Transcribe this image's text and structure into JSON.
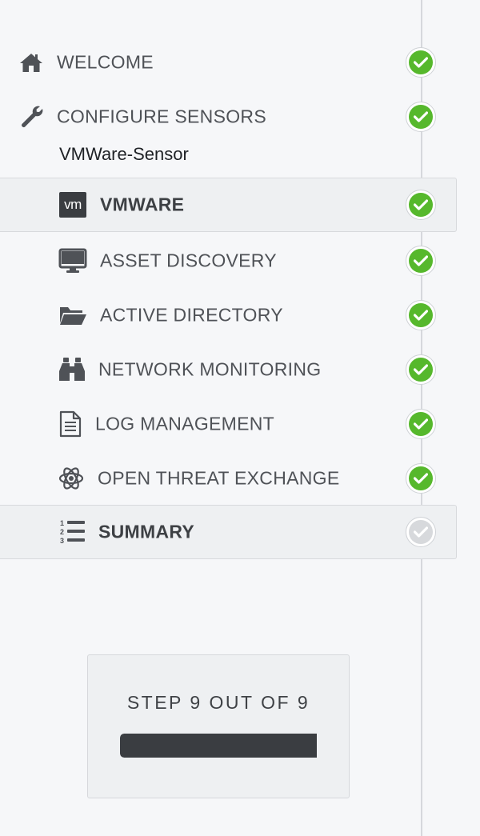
{
  "steps": [
    {
      "label": "WELCOME",
      "icon": "home-icon",
      "status": "complete"
    },
    {
      "label": "CONFIGURE SENSORS",
      "icon": "wrench-icon",
      "status": "complete"
    },
    {
      "label": "VMWARE",
      "icon": "vmware-icon",
      "status": "complete"
    },
    {
      "label": "ASSET DISCOVERY",
      "icon": "monitor-icon",
      "status": "complete"
    },
    {
      "label": "ACTIVE DIRECTORY",
      "icon": "folder-open-icon",
      "status": "complete"
    },
    {
      "label": "NETWORK MONITORING",
      "icon": "binoculars-icon",
      "status": "complete"
    },
    {
      "label": "LOG MANAGEMENT",
      "icon": "document-icon",
      "status": "complete"
    },
    {
      "label": "OPEN THREAT EXCHANGE",
      "icon": "atom-icon",
      "status": "complete"
    },
    {
      "label": "SUMMARY",
      "icon": "numbered-list-icon",
      "status": "pending"
    }
  ],
  "sensor_name": "VMWare-Sensor",
  "vmware_icon_text": "vm",
  "progress": {
    "label": "STEP 9 OUT OF 9",
    "fraction": 1.0
  },
  "colors": {
    "complete": "#56b82c",
    "pending": "#d7d9dc",
    "progress_fill": "#3a3d41"
  }
}
